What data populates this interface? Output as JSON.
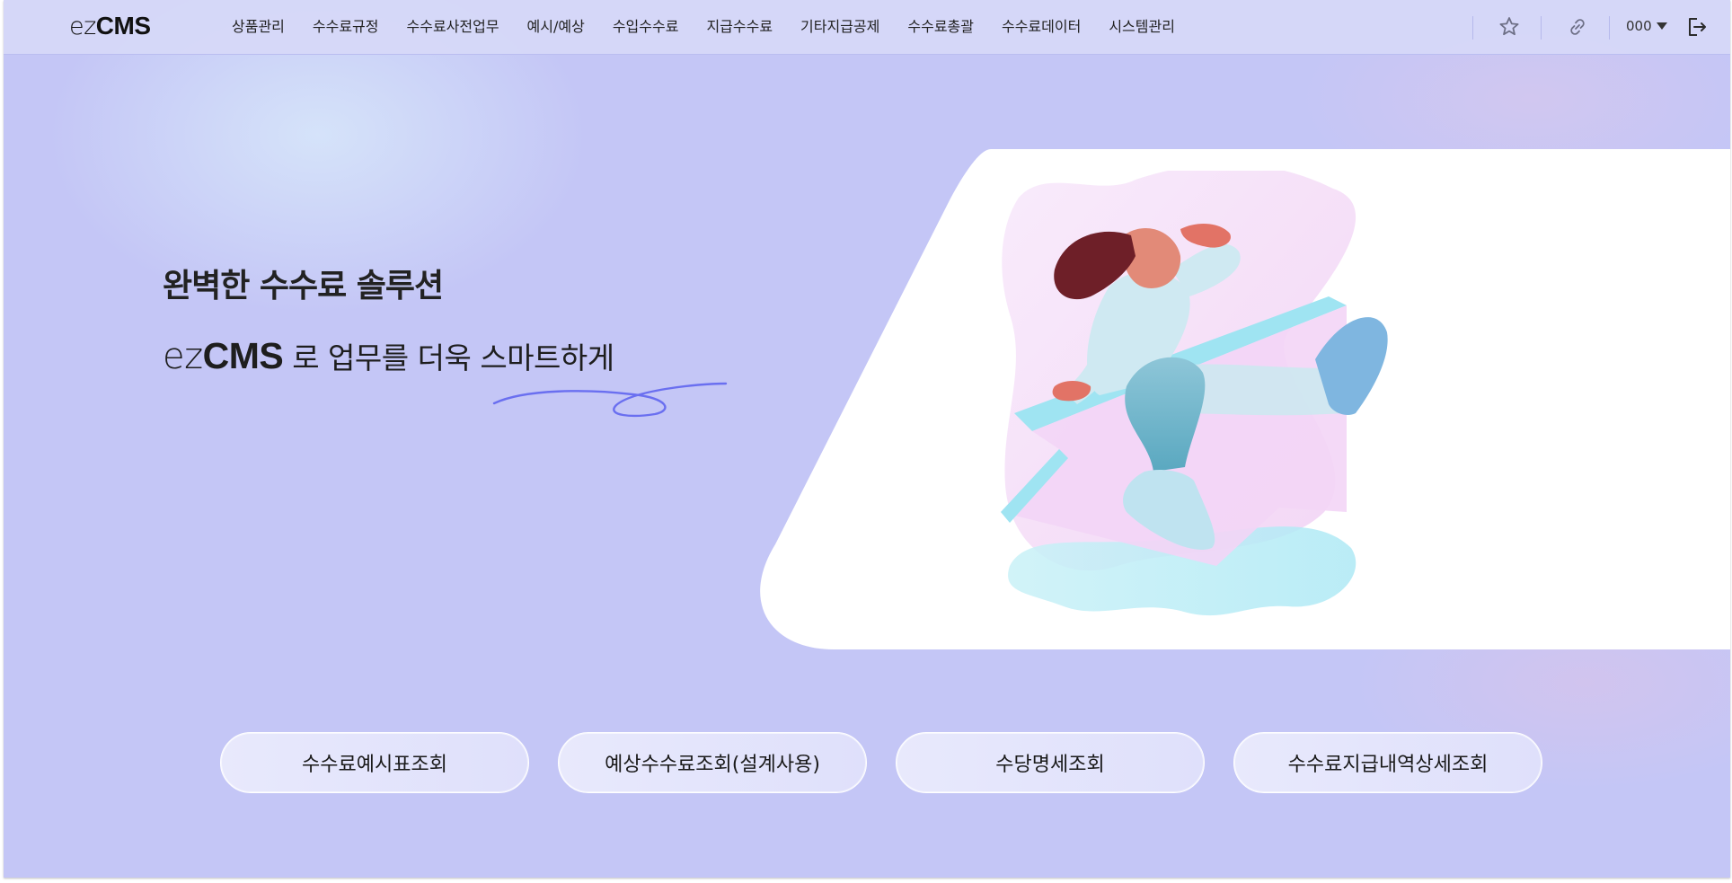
{
  "app": {
    "logo_light": "ez",
    "logo_bold": "CMS"
  },
  "nav": {
    "items": [
      {
        "label": "상품관리"
      },
      {
        "label": "수수료규정"
      },
      {
        "label": "수수료사전업무"
      },
      {
        "label": "예시/예상"
      },
      {
        "label": "수입수수료"
      },
      {
        "label": "지급수수료"
      },
      {
        "label": "기타지급공제"
      },
      {
        "label": "수수료총괄"
      },
      {
        "label": "수수료데이터"
      },
      {
        "label": "시스템관리"
      }
    ]
  },
  "header_tools": {
    "favorite_icon": "star-icon",
    "link_icon": "link-icon",
    "user_name": "000",
    "logout_icon": "logout-icon"
  },
  "hero": {
    "title": "완벽한 수수료 솔루션",
    "subtitle_brand_light": "ez",
    "subtitle_brand_bold": "CMS",
    "subtitle_text": " 로 업무를 더욱 스마트하게"
  },
  "quick_links": [
    {
      "label": "수수료예시표조회"
    },
    {
      "label": "예상수수료조회(설계사용)"
    },
    {
      "label": "수당명세조회"
    },
    {
      "label": "수수료지급내역상세조회"
    }
  ],
  "colors": {
    "background": "#c4c6f6",
    "topbar": "#d6d8f8",
    "accent": "#6a6ff0",
    "button_bg": "#e6e7fc"
  }
}
